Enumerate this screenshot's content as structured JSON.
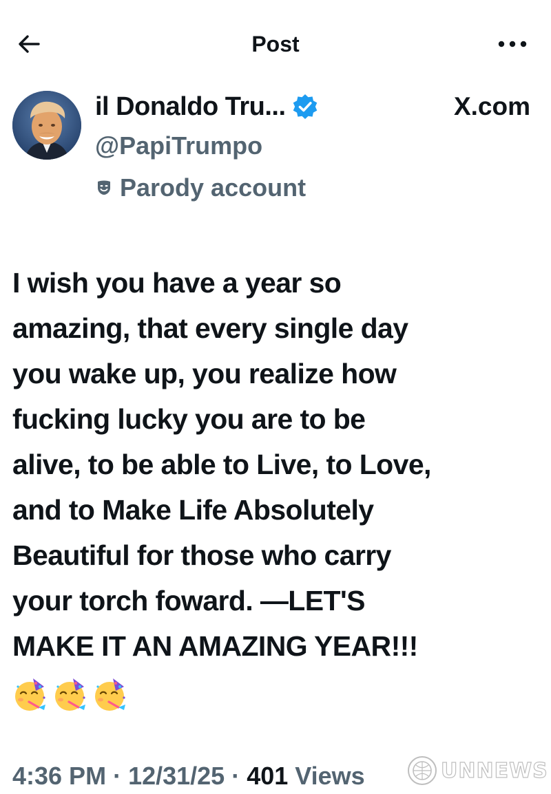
{
  "header": {
    "title": "Post",
    "back_icon": "arrow-left-icon",
    "more_icon": "ellipsis-icon"
  },
  "author": {
    "display_name": "il Donaldo Tru...",
    "handle": "@PapiTrumpo",
    "verified_icon": "verified-badge-icon",
    "verified_color": "#1d9bf0",
    "label_icon": "theater-mask-icon",
    "label": "Parody account",
    "source": "X.com"
  },
  "post": {
    "text": "I wish you have a year so\namazing, that every single day\nyou wake up, you realize how\nfucking lucky you are to be\nalive, to be able to Live, to Love,\nand to Make Life Absolutely\nBeautiful for those who carry\nyour torch foward. —LET'S\nMAKE IT AN AMAZING YEAR!!!",
    "emojis": [
      "partying-face-icon",
      "partying-face-icon",
      "partying-face-icon"
    ]
  },
  "meta": {
    "time": "4:36 PM",
    "separator": "·",
    "date": "12/31/25",
    "views_count": "401",
    "views_label": "Views"
  },
  "watermark": {
    "text": "UNNEWS"
  },
  "colors": {
    "primary_text": "#0f1419",
    "secondary_text": "#536471",
    "background": "#ffffff"
  }
}
